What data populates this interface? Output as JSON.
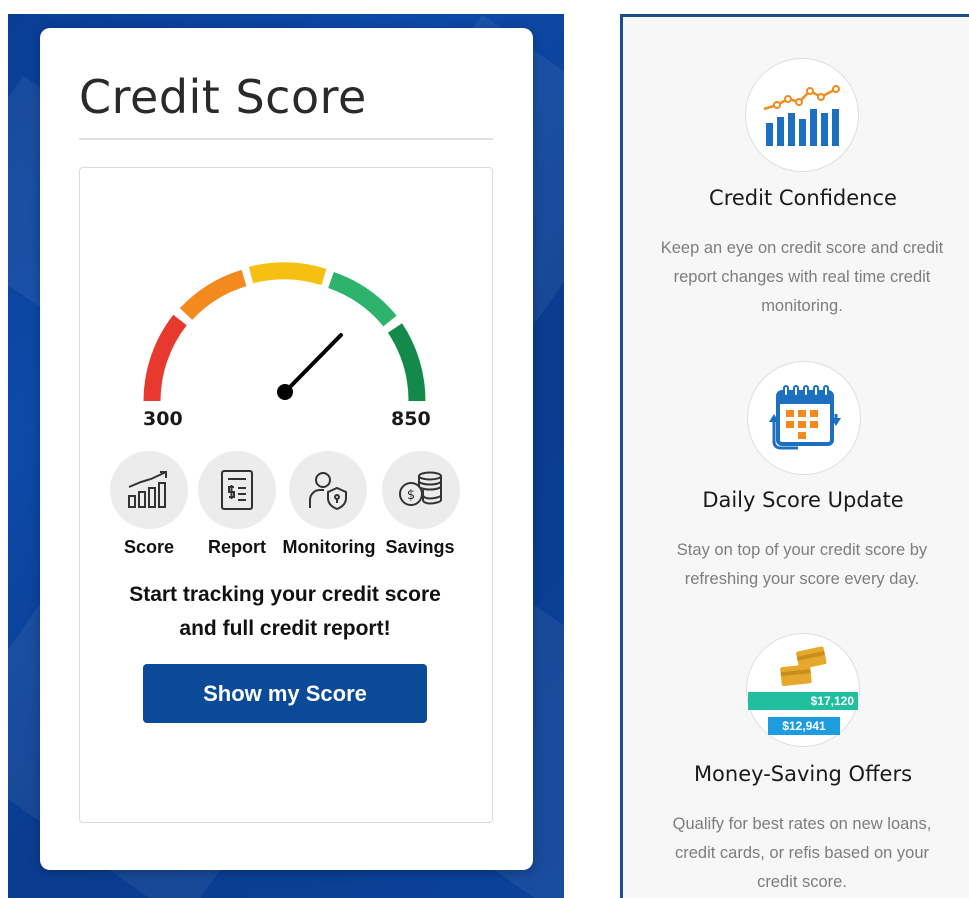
{
  "credit_widget": {
    "title": "Credit Score",
    "gauge": {
      "min_label": "300",
      "max_label": "850"
    },
    "features": [
      {
        "label": "Score",
        "icon": "bar-chart-trend-icon"
      },
      {
        "label": "Report",
        "icon": "report-document-icon"
      },
      {
        "label": "Monitoring",
        "icon": "person-shield-icon"
      },
      {
        "label": "Savings",
        "icon": "coins-stack-icon"
      }
    ],
    "tagline_line1": "Start tracking your credit score",
    "tagline_line2": "and full credit report!",
    "cta_label": "Show my Score"
  },
  "benefits": [
    {
      "title": "Credit Confidence",
      "icon": "chart-trend-icon",
      "desc_line1": "Keep an eye on credit score and credit",
      "desc_line2": "report changes with real time credit",
      "desc_line3": "monitoring."
    },
    {
      "title": "Daily Score Update",
      "icon": "calendar-refresh-icon",
      "desc_line1": "Stay on top of your credit score by",
      "desc_line2": "refreshing your score every day."
    },
    {
      "title": "Money-Saving Offers",
      "icon": "cards-savings-icon",
      "amount_high": "$17,120",
      "amount_low": "$12,941",
      "desc_line1": "Qualify for best rates on new loans,",
      "desc_line2": "credit cards, or refis based on your",
      "desc_line3": "credit score."
    }
  ],
  "colors": {
    "brand_blue": "#0b4a99",
    "gauge_red": "#e8392f",
    "gauge_orange": "#f28a1e",
    "gauge_yellow": "#f6c012",
    "gauge_light_green": "#2db36b",
    "gauge_dark_green": "#148a4a",
    "accent_teal": "#1fbfa0",
    "accent_sky": "#1d9de0",
    "accent_gold": "#e5a82a"
  }
}
